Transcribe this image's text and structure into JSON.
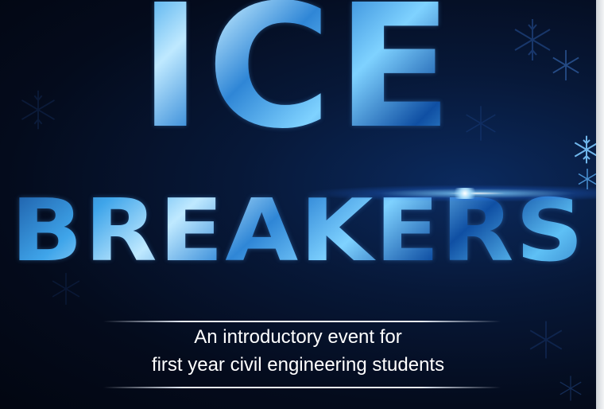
{
  "poster": {
    "title_line1": "ICE",
    "title_line2": "BREAKERS",
    "subtitle_line1": "An introductory event for",
    "subtitle_line2": "first year civil engineering students"
  },
  "colors": {
    "background": "#040b1c",
    "title_ice_blue": "#3fa5ea",
    "title_highlight": "#bfe9ff",
    "text": "#ffffff",
    "page_edge": "#e6e8eb"
  },
  "decorations": {
    "icons": [
      "snowflake-icon",
      "lens-flare"
    ]
  }
}
